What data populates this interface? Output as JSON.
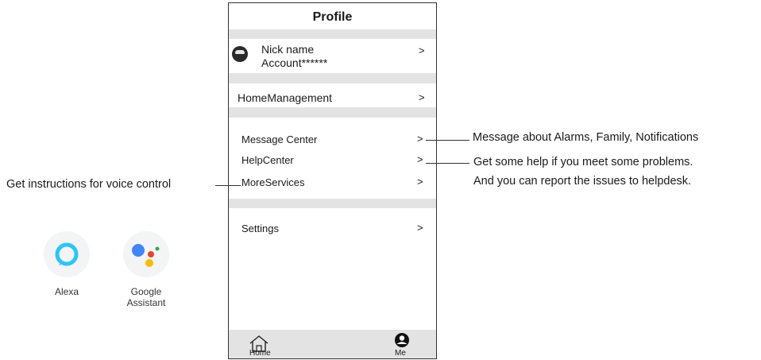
{
  "profile": {
    "title": "Profile",
    "nick_name": "Nick name",
    "account": "Account******",
    "chevron": ">",
    "items": {
      "home_management": "HomeManagement",
      "message_center": "Message Center",
      "help_center": "HelpCenter",
      "more_services": "MoreServices",
      "settings": "Settings"
    },
    "tabs": {
      "home": "Home",
      "me": "Me"
    }
  },
  "annotations": {
    "message": "Message about Alarms, Family, Notifications",
    "help_line1": "Get some help if you meet some problems.",
    "help_line2": "And you can report the issues to helpdesk.",
    "voice": "Get instructions for voice control"
  },
  "assistants": {
    "alexa": "Alexa",
    "google_line1": "Google",
    "google_line2": "Assistant"
  },
  "icon_names": [
    "avatar-icon",
    "home-icon",
    "me-icon",
    "alexa-icon",
    "google-assistant-icon"
  ],
  "colors": {
    "alexa_blue": "#31c4f3",
    "google_blue": "#4285f4",
    "google_red": "#ea4335",
    "google_yellow": "#fbbc05",
    "google_green": "#34a853",
    "band_gray": "#e3e3e3"
  }
}
